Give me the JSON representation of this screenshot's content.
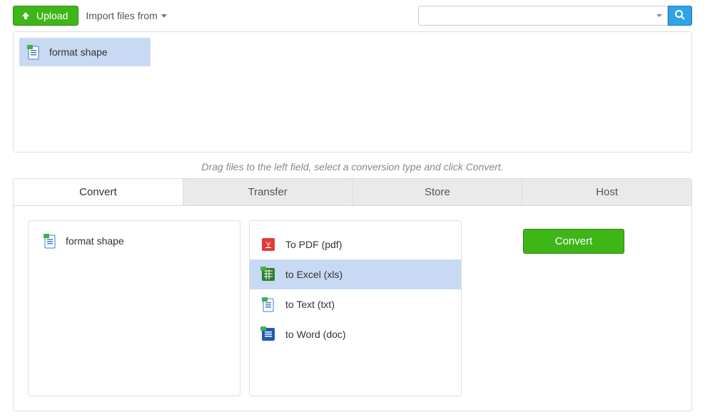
{
  "toolbar": {
    "upload_label": "Upload",
    "import_label": "Import files from",
    "search_value": ""
  },
  "files": {
    "uploaded": [
      {
        "name": "format shape"
      }
    ]
  },
  "hint": "Drag files to the left field, select a conversion type and click Convert.",
  "tabs": [
    {
      "label": "Convert"
    },
    {
      "label": "Transfer"
    },
    {
      "label": "Store"
    },
    {
      "label": "Host"
    }
  ],
  "convert": {
    "selected_file": "format shape",
    "formats": [
      {
        "label": "To PDF (pdf)"
      },
      {
        "label": "to Excel (xls)"
      },
      {
        "label": "to Text (txt)"
      },
      {
        "label": "to Word (doc)"
      }
    ],
    "button_label": "Convert"
  }
}
